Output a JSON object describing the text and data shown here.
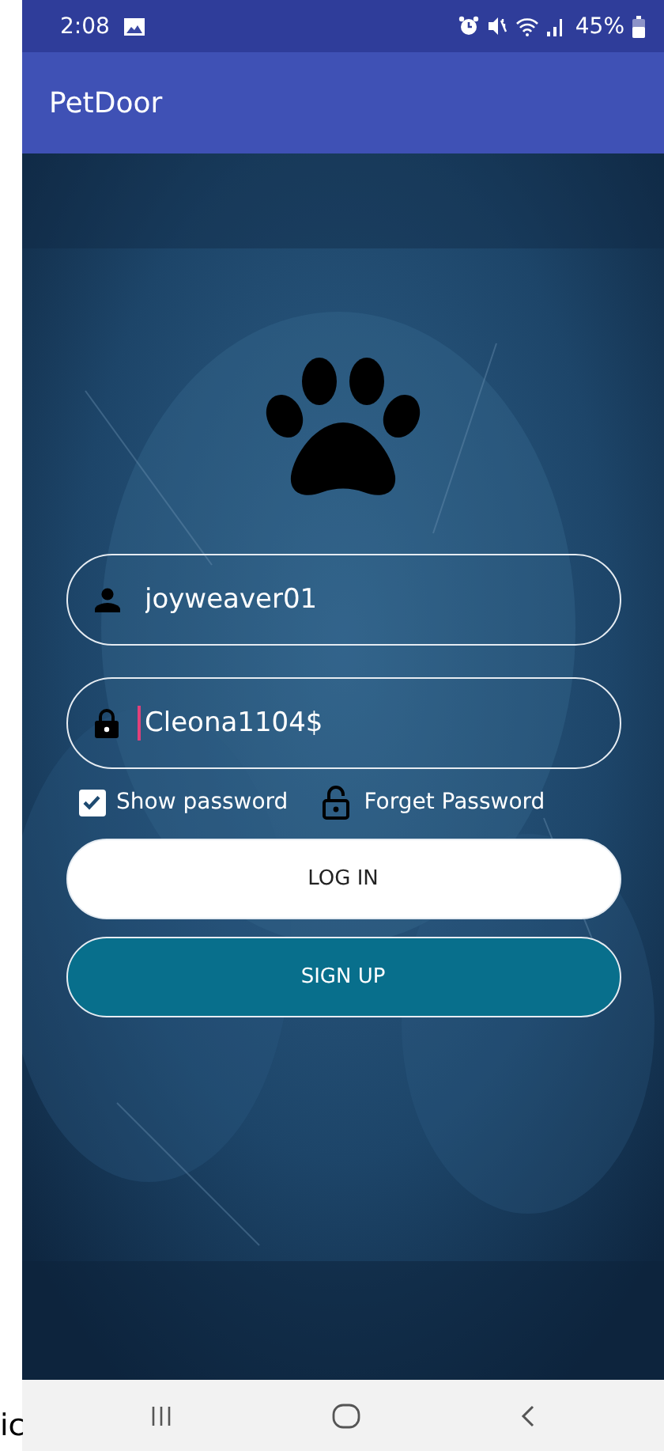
{
  "status_bar": {
    "time": "2:08",
    "battery": "45%"
  },
  "app_bar": {
    "title": "PetDoor"
  },
  "login": {
    "username": {
      "value": "joyweaver01"
    },
    "password": {
      "value": "Cleona1104$",
      "focused": true
    },
    "show_password": {
      "label": "Show password",
      "checked": true
    },
    "forget_password": {
      "label": "Forget Password"
    },
    "buttons": [
      {
        "label": "LOG IN",
        "kind": "primary"
      },
      {
        "label": "SIGN UP",
        "kind": "secondary"
      }
    ]
  },
  "side_text": "ic"
}
